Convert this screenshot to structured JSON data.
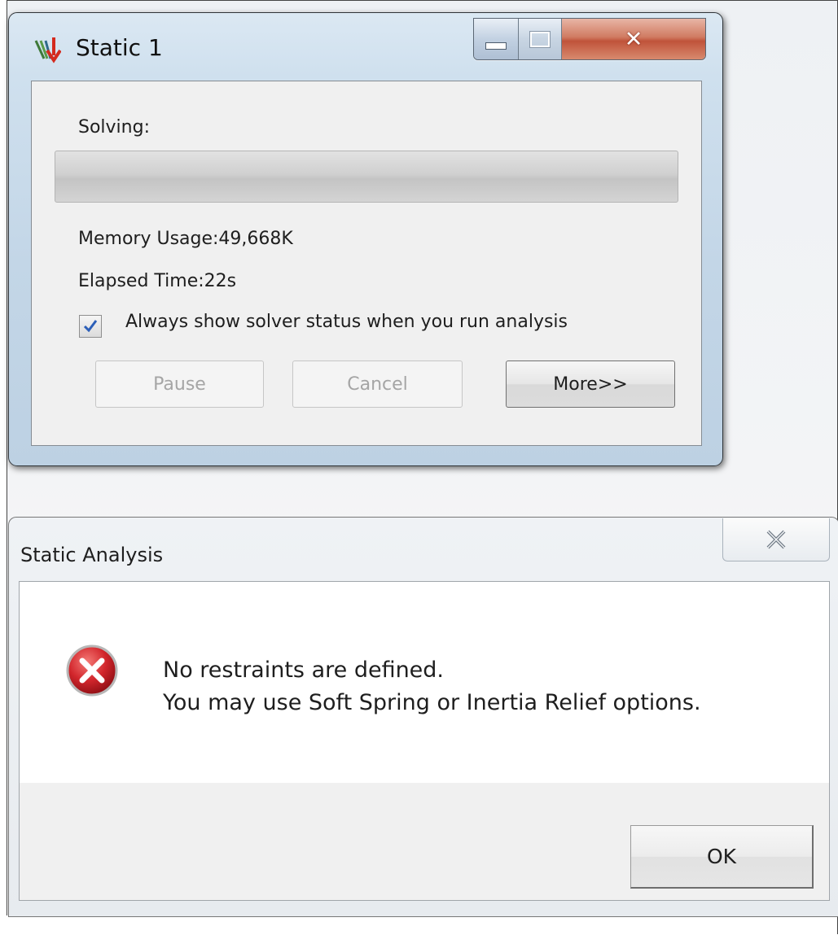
{
  "solver_window": {
    "title": "Static 1",
    "solving_label": "Solving:",
    "progress_fraction": 0,
    "memory_usage": "Memory Usage:49,668K",
    "elapsed_time": "Elapsed Time:22s",
    "always_show_checkbox": {
      "label": "Always show solver status when you run analysis",
      "checked": true
    },
    "buttons": {
      "pause": "Pause",
      "cancel": "Cancel",
      "more": "More>>"
    }
  },
  "message_box": {
    "title": "Static Analysis",
    "message_line1": "No restraints are defined.",
    "message_line2": "You may use Soft Spring or Inertia Relief options.",
    "ok_label": "OK",
    "icon": "error-icon"
  },
  "colors": {
    "error_red": "#d2262c",
    "check_blue": "#2c5fb8",
    "close_red": "#c0533a"
  }
}
